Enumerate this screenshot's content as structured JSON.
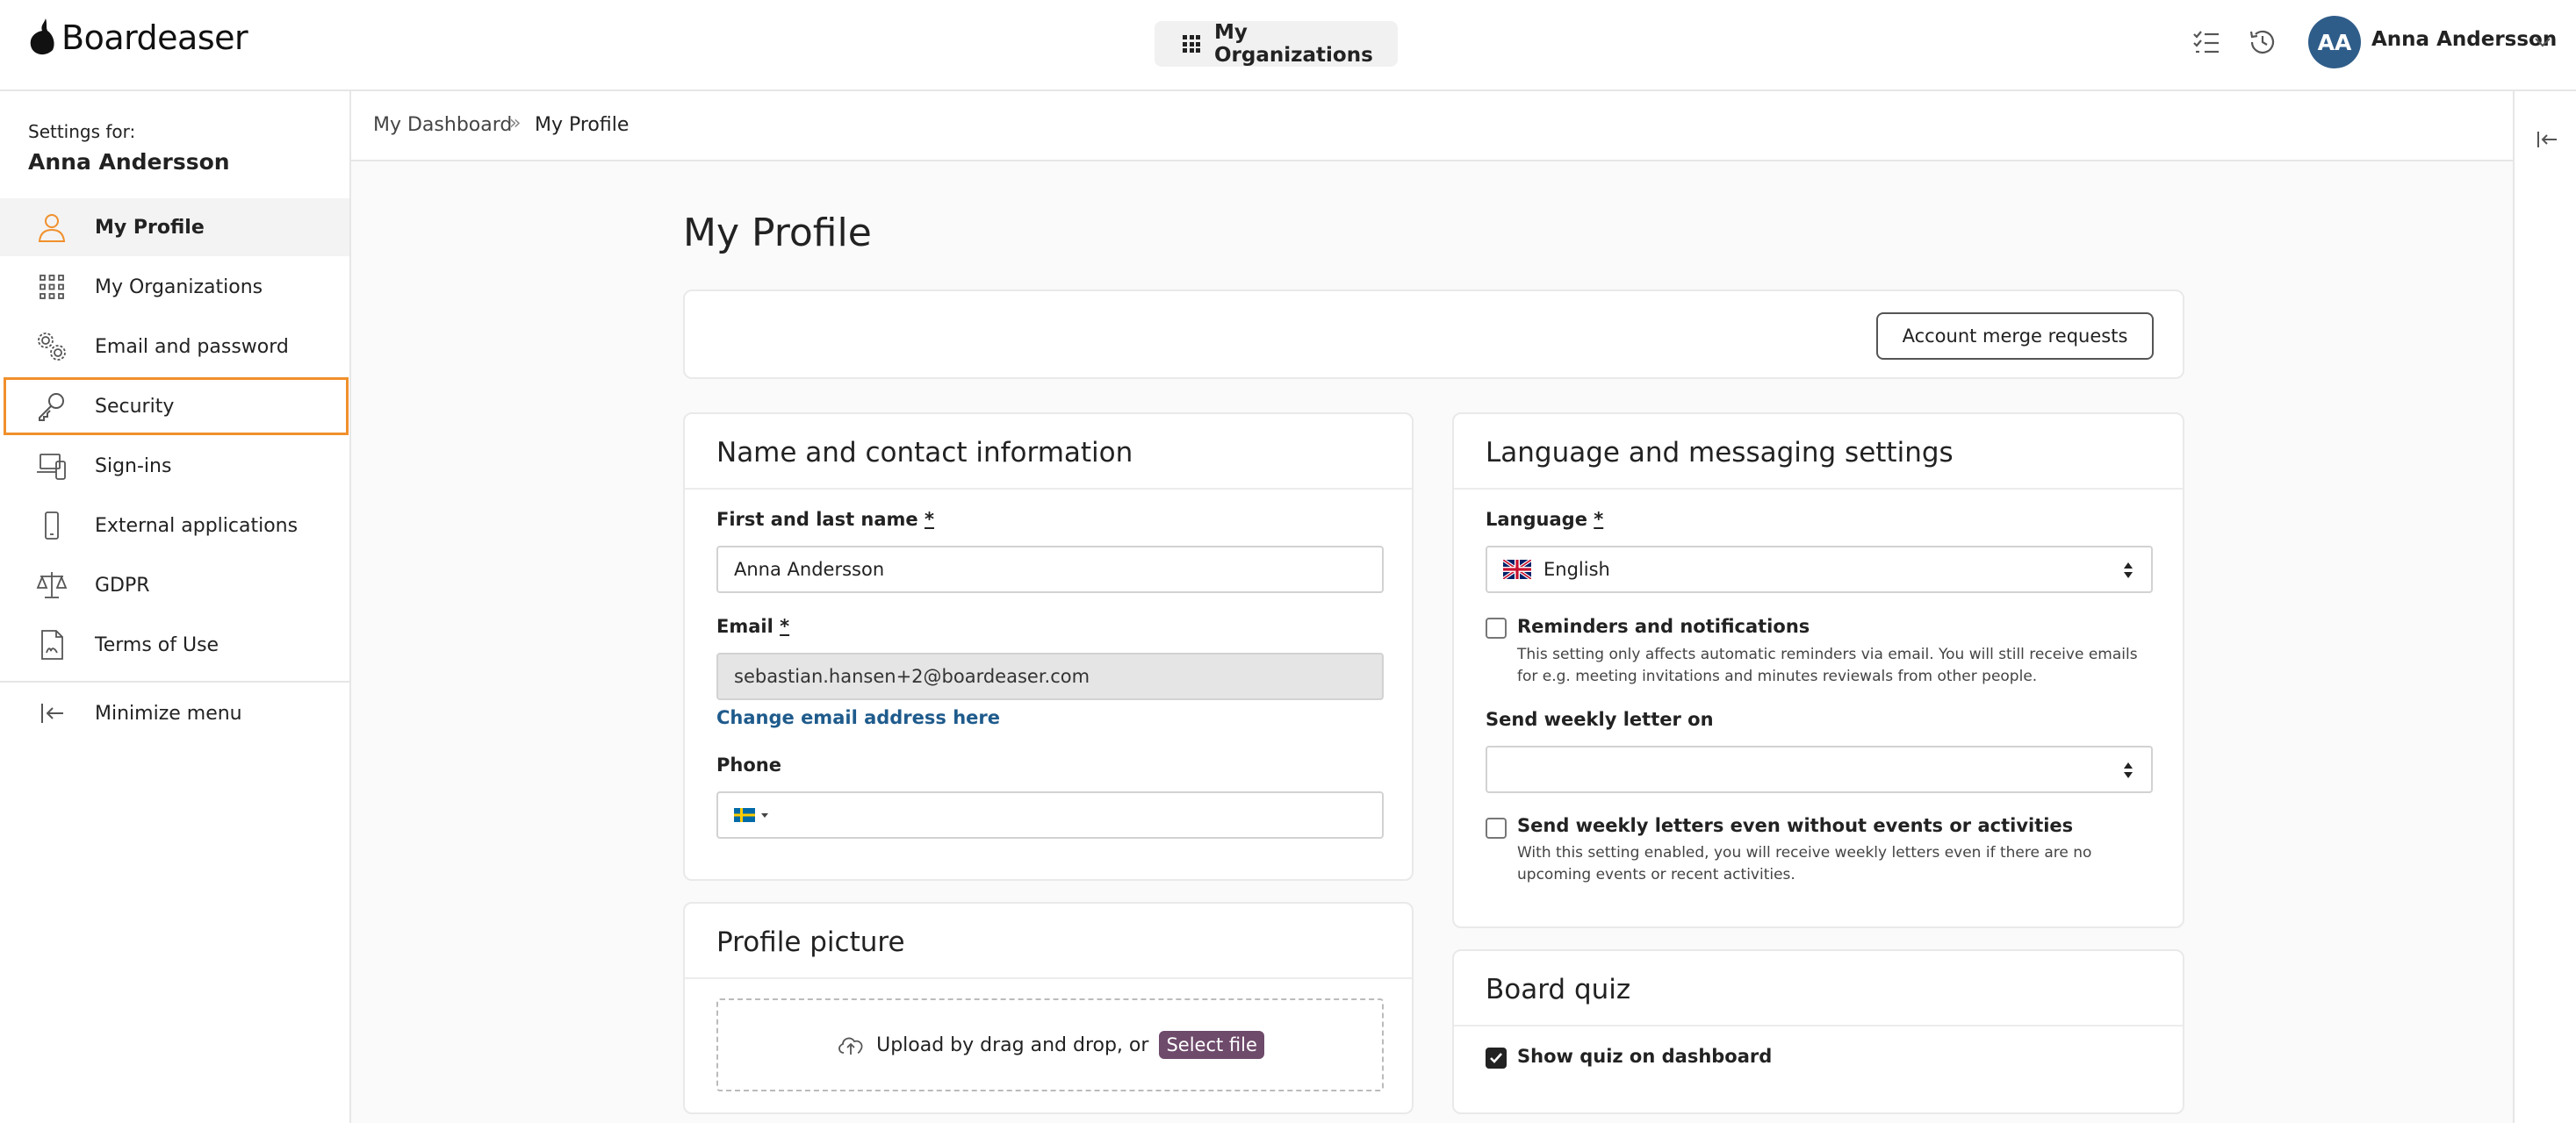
{
  "app": {
    "logo_text": "Boardeaser",
    "org_switch_label": "My Organizations",
    "user": {
      "initials": "AA",
      "name": "Anna Andersson"
    },
    "colors": {
      "accent": "#f0902c",
      "avatar": "#2f5d8a",
      "link": "#1f5b8c",
      "select_file": "#6e4a6b"
    }
  },
  "sidebar": {
    "settings_for": "Settings for:",
    "user_name": "Anna Andersson",
    "items": [
      {
        "label": "My Profile",
        "icon": "user-icon"
      },
      {
        "label": "My Organizations",
        "icon": "grid-icon"
      },
      {
        "label": "Email and password",
        "icon": "gears-icon"
      },
      {
        "label": "Security",
        "icon": "key-icon"
      },
      {
        "label": "Sign-ins",
        "icon": "devices-icon"
      },
      {
        "label": "External applications",
        "icon": "phone-icon"
      },
      {
        "label": "GDPR",
        "icon": "scales-icon"
      },
      {
        "label": "Terms of Use",
        "icon": "document-icon"
      }
    ],
    "minimize": "Minimize menu"
  },
  "breadcrumb": {
    "home": "My Dashboard",
    "sep": "»",
    "current": "My Profile"
  },
  "page": {
    "title": "My Profile"
  },
  "merge": {
    "button": "Account merge requests"
  },
  "contact": {
    "title": "Name and contact information",
    "name_label": "First and last name",
    "name_value": "Anna Andersson",
    "email_label": "Email",
    "email_value": "sebastian.hansen+2@boardeaser.com",
    "change_email": "Change email address here",
    "phone_label": "Phone",
    "required": "*"
  },
  "picture": {
    "title": "Profile picture",
    "upload_text": "Upload by drag and drop, or",
    "select_file": "Select file"
  },
  "language": {
    "title": "Language and messaging settings",
    "language_label": "Language",
    "language_value": "English",
    "reminders_label": "Reminders and notifications",
    "reminders_help": "This setting only affects automatic reminders via email. You will still receive emails for e.g. meeting invitations and minutes reviewals from other people.",
    "weekly_label": "Send weekly letter on",
    "weekly_value": "",
    "weekly_always_label": "Send weekly letters even without events or activities",
    "weekly_always_help": "With this setting enabled, you will receive weekly letters even if there are no upcoming events or recent activities.",
    "required": "*"
  },
  "quiz": {
    "title": "Board quiz",
    "show_label": "Show quiz on dashboard"
  }
}
